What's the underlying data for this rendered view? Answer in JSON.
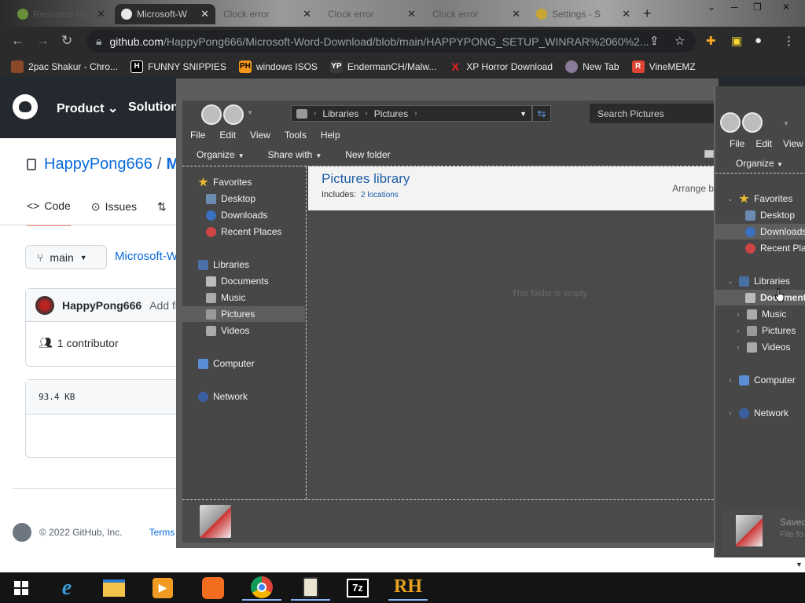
{
  "browser": {
    "tabs": [
      {
        "label": "Resource Ha",
        "active": false
      },
      {
        "label": "Microsoft-W",
        "active": true
      },
      {
        "label": "Clock error",
        "active": false
      },
      {
        "label": "Clock error",
        "active": false
      },
      {
        "label": "Clock error",
        "active": false
      },
      {
        "label": "Settings - S",
        "active": false
      }
    ],
    "new_tab": "+",
    "url_host": "github.com",
    "url_path": "/HappyPong666/Microsoft-Word-Download/blob/main/HAPPYPONG_SETUP_WINRAR%2060%2...",
    "bookmarks": [
      {
        "label": "2pac Shakur - Chro...",
        "icon": "photo-bookmark-icon",
        "color": "#8a4a2a"
      },
      {
        "label": "FUNNY SNIPPIES",
        "icon": "h-bookmark-icon",
        "color": "#000000"
      },
      {
        "label": "windows ISOS",
        "icon": "ph-bookmark-icon",
        "color": "#f7971d"
      },
      {
        "label": "EndermanCH/Malw...",
        "icon": "yp-bookmark-icon",
        "color": "#3a3a3a"
      },
      {
        "label": "XP Horror Download",
        "icon": "x-bookmark-icon",
        "color": "#d22"
      },
      {
        "label": "New Tab",
        "icon": "globe-bookmark-icon",
        "color": "#8a7a9a"
      },
      {
        "label": "VineMEMZ",
        "icon": "r-bookmark-icon",
        "color": "#d43"
      }
    ]
  },
  "github": {
    "nav": [
      "Product",
      "Solutions"
    ],
    "owner": "HappyPong666",
    "slash": "/",
    "repo_initial": "M",
    "tabs": [
      "Code",
      "Issues"
    ],
    "branch": "main",
    "breadcrumb": "Microsoft-W",
    "commit_author": "HappyPong666",
    "commit_msg": "Add fil",
    "contributors": "1 contributor",
    "file_size": "93.4 KB",
    "footer_copyright": "© 2022 GitHub, Inc.",
    "footer_terms": "Terms"
  },
  "explorer": {
    "breadcrumb": [
      "Libraries",
      "Pictures"
    ],
    "search_placeholder": "Search Pictures",
    "menu": [
      "File",
      "Edit",
      "View",
      "Tools",
      "Help"
    ],
    "commands": [
      "Organize",
      "Share with",
      "New folder"
    ],
    "nav": {
      "favorites": "Favorites",
      "favorites_items": [
        "Desktop",
        "Downloads",
        "Recent Places"
      ],
      "libraries": "Libraries",
      "libraries_items": [
        "Documents",
        "Music",
        "Pictures",
        "Videos"
      ],
      "computer": "Computer",
      "network": "Network"
    },
    "library_title": "Pictures library",
    "includes_label": "Includes:",
    "includes_link": "2 locations",
    "arrange_by": "Arrange b",
    "empty_text": "This folder is empty.",
    "details_text": ""
  },
  "explorer2": {
    "menu": [
      "File",
      "Edit",
      "View"
    ],
    "organize": "Organize",
    "nav": {
      "favorites": "Favorites",
      "favorites_items": [
        "Desktop",
        "Downloads",
        "Recent Plac"
      ],
      "libraries": "Libraries",
      "libraries_items": [
        "Documents",
        "Music",
        "Pictures",
        "Videos"
      ],
      "computer": "Computer",
      "network": "Network"
    },
    "status_title": "Saved",
    "status_sub": "File fo"
  },
  "taskbar": {
    "items": [
      "start-button",
      "internet-explorer-icon",
      "file-explorer-icon",
      "media-player-icon",
      "uc-browser-icon",
      "chrome-icon",
      "clipboard-app-icon",
      "7zip-icon",
      "resource-hacker-icon"
    ]
  }
}
